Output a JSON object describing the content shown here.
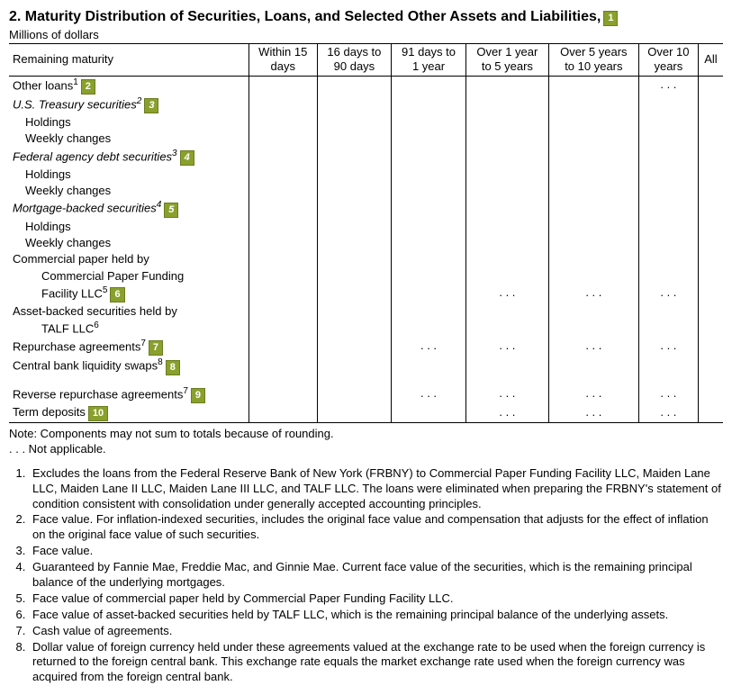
{
  "title": "2. Maturity Distribution of Securities, Loans, and  Selected Other Assets and Liabilities,",
  "title_badge": "1",
  "subtitle": "Millions of dollars",
  "columns": {
    "c0": "Remaining maturity",
    "c1a": "Within 15",
    "c1b": "days",
    "c2a": "16 days to",
    "c2b": "90 days",
    "c3a": "91 days to",
    "c3b": "1 year",
    "c4a": "Over 1 year",
    "c4b": "to 5 years",
    "c5a": "Over 5 years",
    "c5b": "to 10 years",
    "c6a": "Over 10",
    "c6b": "years",
    "c7": "All"
  },
  "rows": {
    "r0": {
      "label": "Other loans",
      "sup": "1",
      "badge": "2"
    },
    "r1": {
      "label": "U.S. Treasury securities",
      "sup": "2",
      "badge": "3"
    },
    "r2": {
      "label": "Holdings"
    },
    "r3": {
      "label": "Weekly changes"
    },
    "r4": {
      "label": "Federal agency debt securities",
      "sup": "3",
      "badge": "4"
    },
    "r5": {
      "label": "Holdings"
    },
    "r6": {
      "label": "Weekly changes"
    },
    "r7": {
      "label": "Mortgage-backed securities",
      "sup": "4",
      "badge": "5"
    },
    "r8": {
      "label": "Holdings"
    },
    "r9": {
      "label": "Weekly changes"
    },
    "r10": {
      "label": "Commercial paper held by"
    },
    "r11": {
      "label": "Commercial Paper Funding"
    },
    "r12": {
      "label": "Facility LLC",
      "sup": "5",
      "badge": "6",
      "d4": ". . .",
      "d5": ". . .",
      "d6": ". . ."
    },
    "r13": {
      "label": "Asset-backed securities held by"
    },
    "r14": {
      "label": "TALF LLC",
      "sup": "6"
    },
    "r15": {
      "label": "Repurchase agreements",
      "sup": "7",
      "badge": "7",
      "d3": ". . .",
      "d4": ". . .",
      "d5": ". . .",
      "d6": ". . ."
    },
    "r16": {
      "label": "Central bank liquidity swaps",
      "sup": "8",
      "badge": "8"
    },
    "r17": {
      "label": "Reverse repurchase agreements",
      "sup": "7",
      "badge": "9",
      "d3": ". . .",
      "d4": ". . .",
      "d5": ". . .",
      "d6": ". . ."
    },
    "r18": {
      "label": "Term deposits",
      "badge": "10",
      "d4": ". . .",
      "d5": ". . .",
      "d6": ". . ."
    }
  },
  "dots_r0": ". . .",
  "note1": "Note: Components may not sum to totals because of rounding.",
  "note2": ". . . Not applicable.",
  "footnotes": {
    "f1": "Excludes the loans from the Federal Reserve Bank of New York (FRBNY) to Commercial Paper Funding Facility LLC, Maiden Lane LLC, Maiden Lane II LLC, Maiden Lane III LLC, and TALF LLC. The loans were eliminated when preparing the FRBNY's statement of condition consistent with consolidation under generally accepted accounting principles.",
    "f2": "Face value. For inflation-indexed securities, includes the original face value and compensation that adjusts for the effect of inflation on the original face value of such securities.",
    "f3": "Face value.",
    "f4": "Guaranteed by Fannie Mae, Freddie Mac, and Ginnie Mae. Current face value of the securities, which is the remaining principal balance of the underlying mortgages.",
    "f5": "Face value of commercial paper held by Commercial Paper Funding Facility LLC.",
    "f6": "Face value of asset-backed securities held by TALF LLC, which is the remaining principal balance of the underlying assets.",
    "f7": "Cash value of agreements.",
    "f8": "Dollar value of foreign currency held under these agreements valued at the exchange rate to be used when the foreign currency is returned to the foreign central bank. This exchange rate equals the market exchange rate used when the foreign currency was acquired from the foreign central bank."
  }
}
